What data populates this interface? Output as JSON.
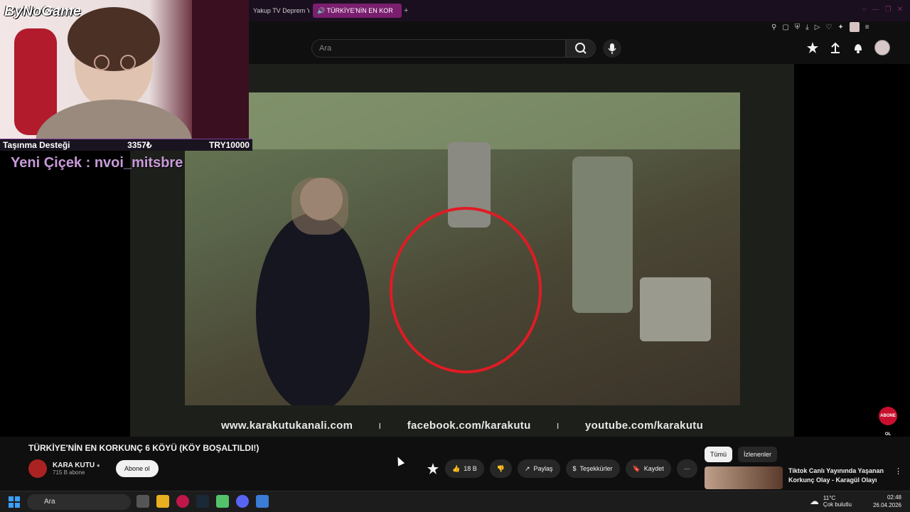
{
  "browser": {
    "tabs": [
      {
        "label": "Yakup TV Deprem Y"
      },
      {
        "label": "TÜRKİYE'NİN EN KOR"
      }
    ],
    "add_tab_icon": "plus-icon"
  },
  "header": {
    "search_placeholder": "Ara"
  },
  "stream_overlay": {
    "logo": "ByNoGame",
    "support_label": "Taşınma Desteği",
    "support_amount": "3357₺",
    "support_goal": "TRY10000",
    "new_follower": "Yeni Çiçek : nvoi_mitsbre"
  },
  "video": {
    "links": [
      "www.karakutukanali.com",
      "facebook.com/karakutu",
      "youtube.com/karakutu"
    ],
    "separator": "ı",
    "title": "TÜRKİYE'NİN EN KORKUNÇ 6 KÖYÜ (KÖY BOŞALTILDI!)",
    "badge": "ABONE OL"
  },
  "channel": {
    "name": "KARA KUTU",
    "subs": "715 B abone",
    "subscribe_label": "Abone ol"
  },
  "actions": {
    "like_count": "18 B",
    "share": "Paylaş",
    "thanks": "Teşekkürler",
    "save": "Kaydet"
  },
  "sidebar": {
    "chips": [
      "Tümü",
      "İzlenenler"
    ],
    "rec_title": "Tiktok Canlı Yayınında Yaşanan Korkunç Olay - Karagül Olayı"
  },
  "taskbar": {
    "search": "Ara",
    "weather_temp": "11°C",
    "weather_desc": "Çok bulutlu",
    "time": "02:48",
    "date": "26.04.2026"
  },
  "colors": {
    "background": "#0f0f0f",
    "accent_tab": "#7a1f6f",
    "circle": "#e01b24"
  }
}
